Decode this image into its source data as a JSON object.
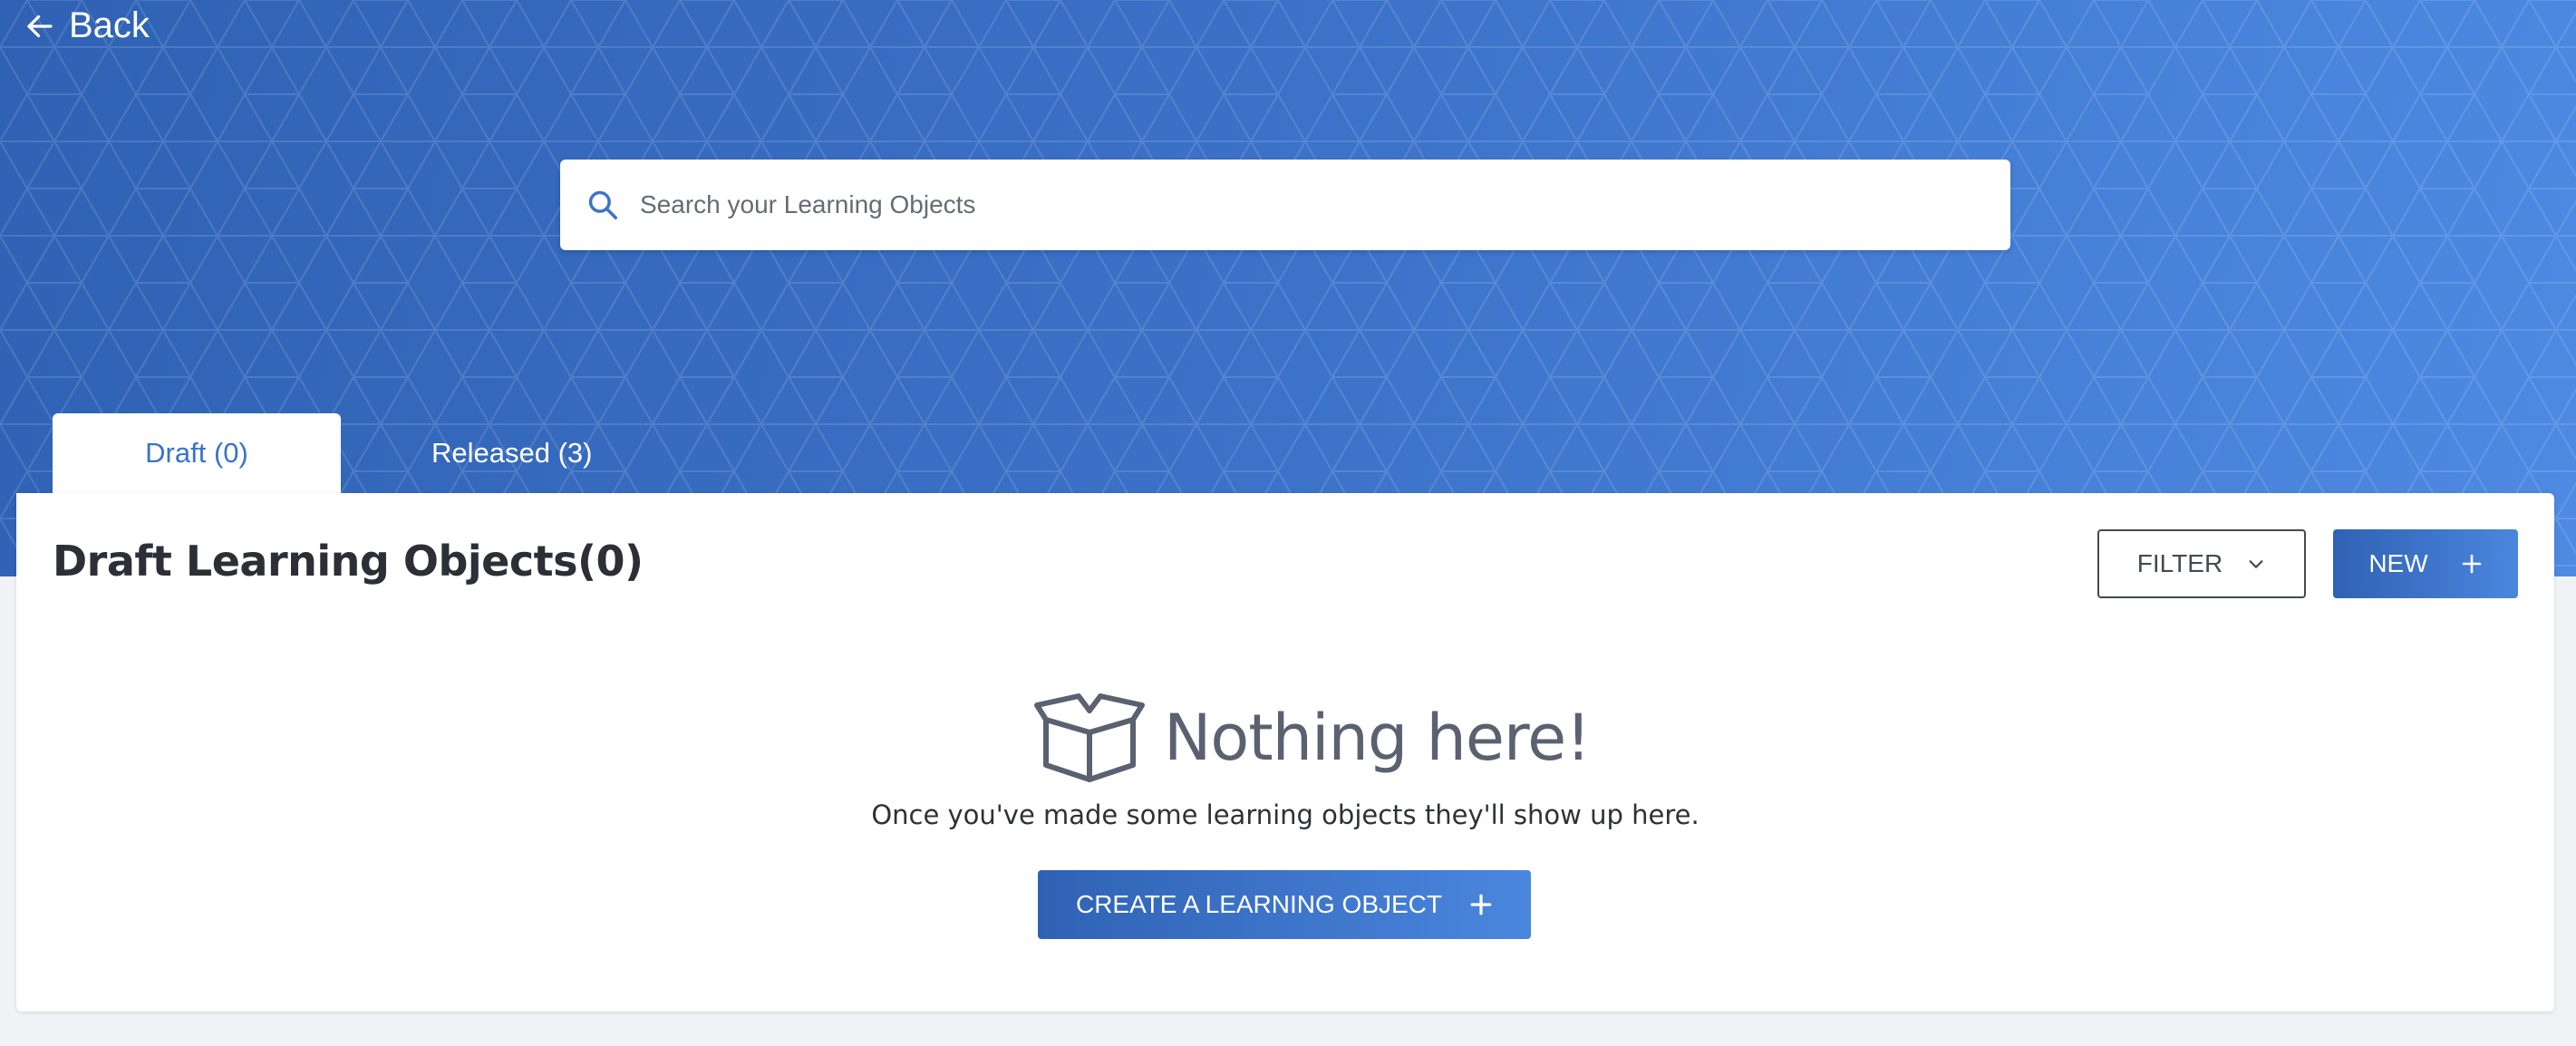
{
  "header": {
    "back_label": "Back",
    "search": {
      "placeholder": "Search your Learning Objects",
      "value": ""
    }
  },
  "tabs": [
    {
      "label": "Draft (0)",
      "active": true
    },
    {
      "label": "Released (3)",
      "active": false
    }
  ],
  "main": {
    "title": "Draft Learning Objects(0)",
    "filter_label": "FILTER",
    "new_label": "NEW",
    "empty_state": {
      "icon": "open-box-icon",
      "title": "Nothing here!",
      "message": "Once you've made some learning objects they'll show up here.",
      "cta_label": "CREATE A LEARNING OBJECT"
    }
  },
  "colors": {
    "hero_start": "#2f62b4",
    "hero_end": "#4e8ae2",
    "accent": "#3a73c9",
    "text_dark": "#2c2f36",
    "muted": "#5a6170",
    "page_bg": "#f1f2f5"
  }
}
